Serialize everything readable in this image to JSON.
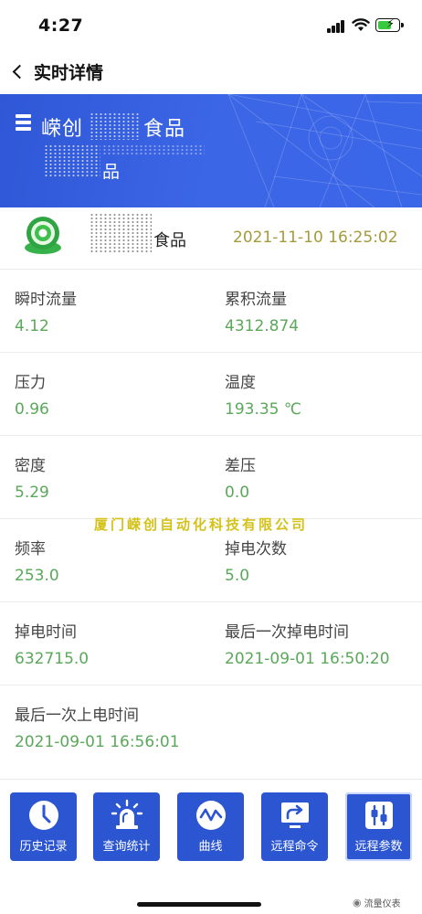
{
  "status": {
    "time": "4:27"
  },
  "nav": {
    "title": "实时详情"
  },
  "banner": {
    "company_name": "嵘创",
    "company_suffix": "食品",
    "subtitle": "品"
  },
  "device": {
    "name_suffix": "食品",
    "timestamp": "2021-11-10 16:25:02"
  },
  "metrics": [
    {
      "left": {
        "label": "瞬时流量",
        "value": "4.12"
      },
      "right": {
        "label": "累积流量",
        "value": "4312.874"
      }
    },
    {
      "left": {
        "label": "压力",
        "value": "0.96"
      },
      "right": {
        "label": "温度",
        "value": "193.35 ℃"
      }
    },
    {
      "left": {
        "label": "密度",
        "value": "5.29"
      },
      "right": {
        "label": "差压",
        "value": "0.0"
      }
    },
    {
      "left": {
        "label": "频率",
        "value": "253.0"
      },
      "right": {
        "label": "掉电次数",
        "value": "5.0"
      }
    },
    {
      "left": {
        "label": "掉电时间",
        "value": "632715.0"
      },
      "right": {
        "label": "最后一次掉电时间",
        "value": "2021-09-01 16:50:20"
      }
    },
    {
      "left": {
        "label": "最后一次上电时间",
        "value": "2021-09-01 16:56:01"
      }
    }
  ],
  "watermark": "厦门嵘创自动化科技有限公司",
  "actions": [
    {
      "label": "历史记录",
      "icon": "clock-icon"
    },
    {
      "label": "查询统计",
      "icon": "alarm-light-icon"
    },
    {
      "label": "曲线",
      "icon": "wave-icon"
    },
    {
      "label": "远程命令",
      "icon": "share-screen-icon"
    },
    {
      "label": "远程参数",
      "icon": "sliders-icon"
    }
  ],
  "footer": {
    "brand": "流量仪表"
  },
  "colors": {
    "banner": "#3a64e4",
    "value_text": "#5aa85a",
    "timestamp_text": "#a59a3c",
    "action_button": "#2b55d1"
  }
}
